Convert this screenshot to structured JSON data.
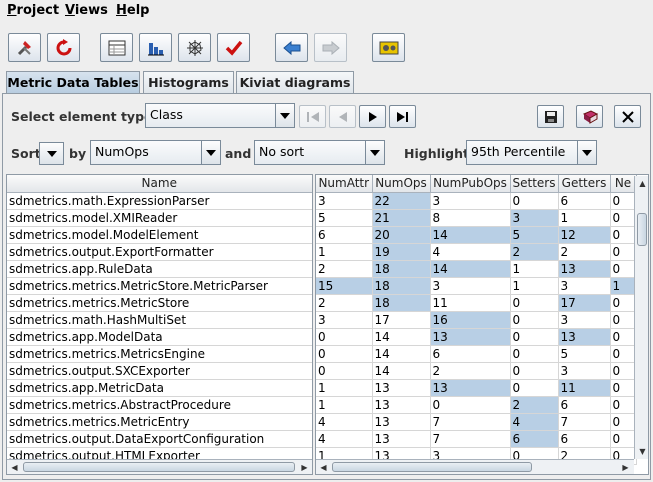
{
  "menu": [
    {
      "label_first": "P",
      "label_rest": "roject"
    },
    {
      "label_first": "V",
      "label_rest": "iews"
    },
    {
      "label_first": "H",
      "label_rest": "elp"
    }
  ],
  "toolbar": [
    {
      "icon": "wrench-hammer-icon"
    },
    {
      "icon": "refresh-icon"
    },
    {
      "icon": "table-icon"
    },
    {
      "icon": "bar-chart-icon"
    },
    {
      "icon": "kiviat-icon"
    },
    {
      "icon": "checkmark-icon"
    },
    {
      "icon": "back-arrow-icon"
    },
    {
      "icon": "forward-arrow-icon",
      "disabled": true
    },
    {
      "icon": "gears-icon"
    }
  ],
  "tabs": [
    {
      "label": "Metric Data Tables",
      "active": true
    },
    {
      "label": "Histograms",
      "active": false
    },
    {
      "label": "Kiviat diagrams",
      "active": false
    }
  ],
  "controls": {
    "select_label": "Select element type",
    "element_type": "Class",
    "sort_label": "Sort",
    "by_label": "by",
    "sort_by": "NumOps",
    "and_label": "and",
    "then_by": "No sort",
    "highlight_label": "Highlight",
    "highlight": "95th Percentile"
  },
  "left_table": {
    "header": "Name",
    "rows": [
      "sdmetrics.math.ExpressionParser",
      "sdmetrics.model.XMIReader",
      "sdmetrics.model.ModelElement",
      "sdmetrics.output.ExportFormatter",
      "sdmetrics.app.RuleData",
      "sdmetrics.metrics.MetricStore.MetricParser",
      "sdmetrics.metrics.MetricStore",
      "sdmetrics.math.HashMultiSet",
      "sdmetrics.app.ModelData",
      "sdmetrics.metrics.MetricsEngine",
      "sdmetrics.output.SXCExporter",
      "sdmetrics.app.MetricData",
      "sdmetrics.metrics.AbstractProcedure",
      "sdmetrics.metrics.MetricEntry",
      "sdmetrics.output.DataExportConfiguration",
      "sdmetrics.output.HTMLExporter"
    ]
  },
  "right_table": {
    "headers": [
      "NumAttr",
      "NumOps",
      "NumPubOps",
      "Setters",
      "Getters",
      "Ne"
    ],
    "rows": [
      [
        [
          "3",
          0
        ],
        [
          "22",
          1
        ],
        [
          "3",
          0
        ],
        [
          "0",
          0
        ],
        [
          "6",
          0
        ],
        [
          "0",
          0
        ]
      ],
      [
        [
          "5",
          0
        ],
        [
          "21",
          1
        ],
        [
          "8",
          0
        ],
        [
          "3",
          1
        ],
        [
          "1",
          0
        ],
        [
          "0",
          0
        ]
      ],
      [
        [
          "6",
          0
        ],
        [
          "20",
          1
        ],
        [
          "14",
          1
        ],
        [
          "5",
          1
        ],
        [
          "12",
          1
        ],
        [
          "0",
          0
        ]
      ],
      [
        [
          "1",
          0
        ],
        [
          "19",
          1
        ],
        [
          "4",
          0
        ],
        [
          "2",
          1
        ],
        [
          "2",
          0
        ],
        [
          "0",
          0
        ]
      ],
      [
        [
          "2",
          0
        ],
        [
          "18",
          1
        ],
        [
          "14",
          1
        ],
        [
          "1",
          0
        ],
        [
          "13",
          1
        ],
        [
          "0",
          0
        ]
      ],
      [
        [
          "15",
          1
        ],
        [
          "18",
          1
        ],
        [
          "3",
          0
        ],
        [
          "1",
          0
        ],
        [
          "3",
          0
        ],
        [
          "1",
          1
        ]
      ],
      [
        [
          "2",
          0
        ],
        [
          "18",
          1
        ],
        [
          "11",
          0
        ],
        [
          "0",
          0
        ],
        [
          "17",
          1
        ],
        [
          "0",
          0
        ]
      ],
      [
        [
          "3",
          0
        ],
        [
          "17",
          0
        ],
        [
          "16",
          1
        ],
        [
          "0",
          0
        ],
        [
          "3",
          0
        ],
        [
          "0",
          0
        ]
      ],
      [
        [
          "0",
          0
        ],
        [
          "14",
          0
        ],
        [
          "13",
          1
        ],
        [
          "0",
          0
        ],
        [
          "13",
          1
        ],
        [
          "0",
          0
        ]
      ],
      [
        [
          "0",
          0
        ],
        [
          "14",
          0
        ],
        [
          "6",
          0
        ],
        [
          "0",
          0
        ],
        [
          "5",
          0
        ],
        [
          "0",
          0
        ]
      ],
      [
        [
          "0",
          0
        ],
        [
          "14",
          0
        ],
        [
          "2",
          0
        ],
        [
          "0",
          0
        ],
        [
          "3",
          0
        ],
        [
          "0",
          0
        ]
      ],
      [
        [
          "1",
          0
        ],
        [
          "13",
          0
        ],
        [
          "13",
          1
        ],
        [
          "0",
          0
        ],
        [
          "11",
          1
        ],
        [
          "0",
          0
        ]
      ],
      [
        [
          "1",
          0
        ],
        [
          "13",
          0
        ],
        [
          "0",
          0
        ],
        [
          "2",
          1
        ],
        [
          "6",
          0
        ],
        [
          "0",
          0
        ]
      ],
      [
        [
          "4",
          0
        ],
        [
          "13",
          0
        ],
        [
          "7",
          0
        ],
        [
          "4",
          1
        ],
        [
          "7",
          0
        ],
        [
          "0",
          0
        ]
      ],
      [
        [
          "4",
          0
        ],
        [
          "13",
          0
        ],
        [
          "7",
          0
        ],
        [
          "6",
          1
        ],
        [
          "6",
          0
        ],
        [
          "0",
          0
        ]
      ],
      [
        [
          "1",
          0
        ],
        [
          "13",
          0
        ],
        [
          "3",
          0
        ],
        [
          "0",
          0
        ],
        [
          "2",
          0
        ],
        [
          "0",
          0
        ]
      ]
    ]
  },
  "colors": {
    "highlight": "#b8cfe5",
    "accent_red": "#cc1111",
    "accent_blue": "#2255aa"
  }
}
